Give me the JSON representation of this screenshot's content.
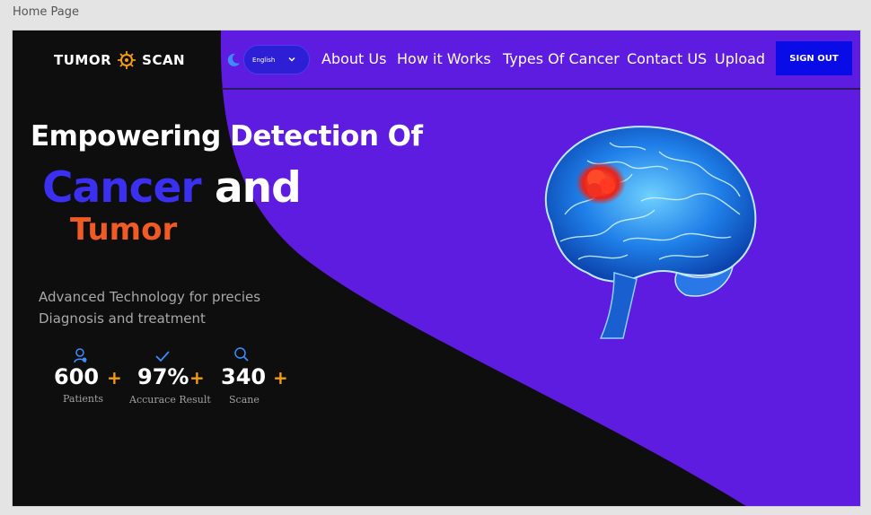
{
  "frame": {
    "title": "Home Page"
  },
  "header": {
    "logo_left": "TUMOR",
    "logo_right": "SCAN",
    "language": "English",
    "nav": [
      "About Us",
      "How it Works",
      "Types Of Cancer",
      "Contact US",
      "Upload"
    ],
    "signout_label": "SIGN OUT"
  },
  "hero": {
    "line1": "Empowering Detection Of",
    "line2_accent": "Cancer",
    "line2_rest": "and",
    "line3": "Tumor",
    "description": "Advanced Technology for precies Diagnosis and treatment"
  },
  "stats": [
    {
      "value": "600",
      "plus": "+",
      "label": "Patients",
      "icon": "patient-icon"
    },
    {
      "value": "97%",
      "plus": "+",
      "label": "Accurace Result",
      "icon": "check-icon"
    },
    {
      "value": "340",
      "plus": "+",
      "label": "Scane",
      "icon": "search-icon"
    }
  ],
  "colors": {
    "primary_purple": "#5e1ce0",
    "dark_bg": "#0e0e0e",
    "accent_blue": "#3b2ff0",
    "accent_orange": "#f05a24",
    "plus_orange": "#f39c12",
    "button_blue": "#0a0ce8"
  }
}
